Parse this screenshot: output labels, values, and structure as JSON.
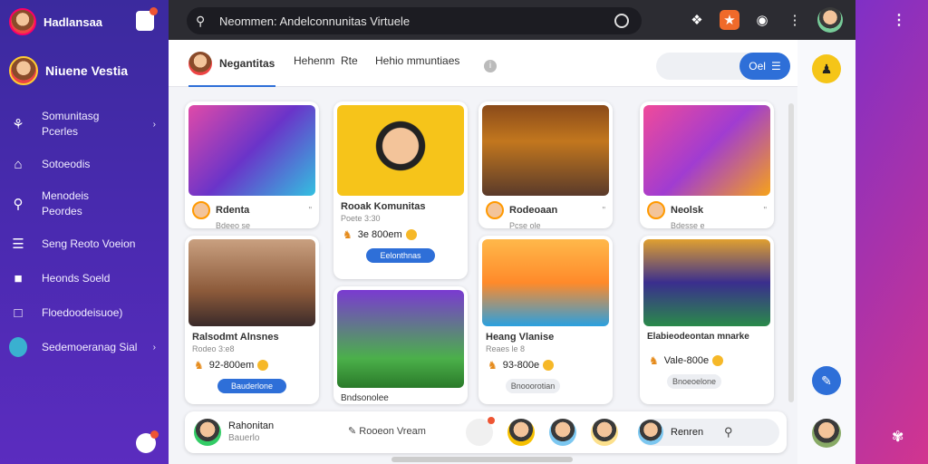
{
  "sidebar": {
    "brand": "Hadlansaa",
    "user": "Niuene Vestia",
    "items": [
      {
        "icon": "people-icon",
        "label": "Somunitasg\nPcerles",
        "chevron": "›"
      },
      {
        "icon": "home-icon",
        "label": "Sotoeodis"
      },
      {
        "icon": "search-icon",
        "label": "Menodeis\nPeordes"
      },
      {
        "icon": "list-icon",
        "label": "Seng Reoto Voeion"
      },
      {
        "icon": "user-icon",
        "label": "Heonds Soeld"
      },
      {
        "icon": "folder-icon",
        "label": "Floedoodeisuoe)"
      },
      {
        "icon": "avatar-icon",
        "label": "Sedemoeranag Sial",
        "chevron": "›"
      }
    ]
  },
  "topbar": {
    "search_text": "Neommen: Andelconnunitas Virtuele"
  },
  "tabs": {
    "active": "Negantitas",
    "items": [
      "Hehenm",
      "Rte",
      "Hehio mmuntiaes"
    ],
    "info": "i",
    "button": "Oel"
  },
  "cards": [
    {
      "title": "Rdenta",
      "sub": "Bdeeo se",
      "quote": "\"",
      "img": "#6a34c9"
    },
    {
      "title": "Rooak Komunitas",
      "sub": "Poete 3:30",
      "price": "3e 800em",
      "button": "Eelonthnas",
      "img": "#f6c41a"
    },
    {
      "title": "Rodeoaan",
      "sub": "Pcse ole",
      "quote": "\"",
      "img": "#c2771e"
    },
    {
      "title": "Neolsk",
      "sub": "Bdesse e",
      "quote": "\"",
      "img": "#a03cd1"
    },
    {
      "title": "Ralsodmt Alnsnes",
      "sub": "Rodeo 3:e8",
      "price": "92-800em",
      "button": "Bauderlone",
      "img": "#8c5a3a"
    },
    {
      "title": "Bndsonolee",
      "sub": "",
      "img": "#4bb04a"
    },
    {
      "title": "Heang Vlanise",
      "sub": "Reaes le 8",
      "price": "93-800e",
      "gray": "Bnooorotian",
      "img": "#ff8a2a"
    },
    {
      "title": "Elabieodeontan mnarke",
      "sub": "",
      "price": "Vale-800e",
      "gray": "Bnoeoelone",
      "img": "#3a2e8e"
    }
  ],
  "bottom": {
    "name": "Rahonitan",
    "sub": "Bauerlo",
    "chip": "Rooeon Vream",
    "search": "Renren"
  }
}
